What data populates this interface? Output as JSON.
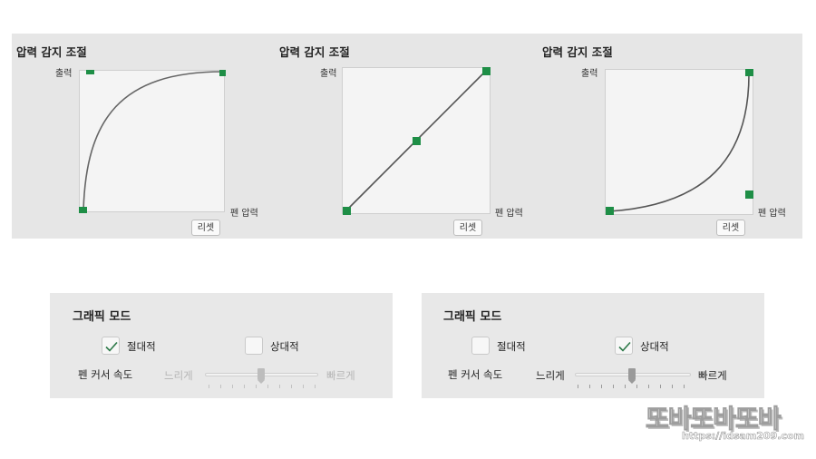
{
  "pressure_panels": [
    {
      "title": "압력 감지 조절",
      "output_label": "출력",
      "input_label": "펜 압력",
      "reset_label": "리셋",
      "curve": "soft"
    },
    {
      "title": "압력 감지 조절",
      "output_label": "출력",
      "input_label": "펜 압력",
      "reset_label": "리셋",
      "curve": "linear"
    },
    {
      "title": "압력 감지 조절",
      "output_label": "출력",
      "input_label": "펜 압력",
      "reset_label": "리셋",
      "curve": "hard"
    }
  ],
  "graphics_panels": [
    {
      "title": "그래픽 모드",
      "absolute_label": "절대적",
      "absolute_checked": true,
      "relative_label": "상대적",
      "relative_checked": false,
      "speed_label": "펜 커서 속도",
      "slow_label": "느리게",
      "fast_label": "빠르게",
      "speed_enabled": false,
      "speed_value": 0.5
    },
    {
      "title": "그래픽 모드",
      "absolute_label": "절대적",
      "absolute_checked": false,
      "relative_label": "상대적",
      "relative_checked": true,
      "speed_label": "펜 커서 속도",
      "slow_label": "느리게",
      "fast_label": "빠르게",
      "speed_enabled": true,
      "speed_value": 0.5
    }
  ],
  "watermark": {
    "logo_text": "또바또바또바",
    "url_text": "https://idsam209.com"
  },
  "colors": {
    "handle": "#1e8e46",
    "curve": "#666666",
    "plot_bg": "#f4f4f4",
    "panel_bg": "#e6e6e6",
    "disabled_text": "#b5b5b5"
  }
}
